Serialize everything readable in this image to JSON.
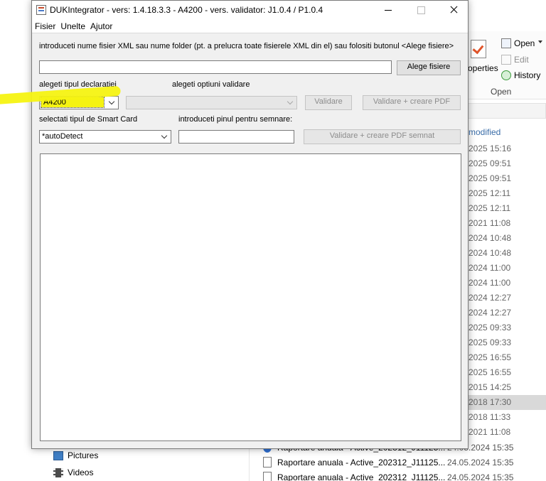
{
  "background": {
    "ribbon": {
      "properties_label": "operties",
      "open_label": "Open",
      "edit_label": "Edit",
      "history_label": "History",
      "group_label": "Open"
    },
    "column_header": "modified",
    "dates": [
      "2025 15:16",
      "2025 09:51",
      "2025 09:51",
      "2025 12:11",
      "2025 12:11",
      "2021 11:08",
      "2024 10:48",
      "2024 10:48",
      "2024 11:00",
      "2024 11:00",
      "2024 12:27",
      "2024 12:27",
      "2025 09:33",
      "2025 09:33",
      "2025 16:55",
      "2025 16:55",
      "2015 14:25",
      "2018 17:30",
      "2018 11:33",
      "2021 11:08"
    ],
    "nav": {
      "pictures": "Pictures",
      "videos": "Videos"
    },
    "files": [
      {
        "name": "Raportare anuala - Active_202312_J11125...",
        "date": "24.05.2024 15:35"
      },
      {
        "name": "Raportare anuala - Active_202312_J11125...",
        "date": "24.05.2024 15:35"
      },
      {
        "name": "Raportare anuala - Active_202312_J11125...",
        "date": "24.05.2024 15:35"
      }
    ]
  },
  "window": {
    "title": "DUKIntegrator - vers: 1.4.18.3.3 - A4200 - vers. validator: J1.0.4 / P1.0.4",
    "menu": [
      "Fisier",
      "Unelte",
      "Ajutor"
    ],
    "instruction": "introduceti nume fisier XML sau nume folder (pt. a prelucra toate fisierele XML din el) sau folositi butonul <Alege fisiere>",
    "file_input_value": "",
    "choose_files_button": "Alege fisiere",
    "declaration_type_label": "alegeti tipul declaratiei",
    "declaration_type_value": "A4200",
    "validation_options_label": "alegeti optiuni validare",
    "validation_options_value": "",
    "validate_button": "Validare",
    "validate_pdf_button": "Validare + creare PDF",
    "smart_card_label": "selectati tipul de Smart Card",
    "smart_card_value": "*autoDetect",
    "pin_label": "introduceti pinul pentru semnare:",
    "pin_value": "",
    "validate_pdf_signed_button": "Validare + creare PDF semnat",
    "output_text": ""
  }
}
